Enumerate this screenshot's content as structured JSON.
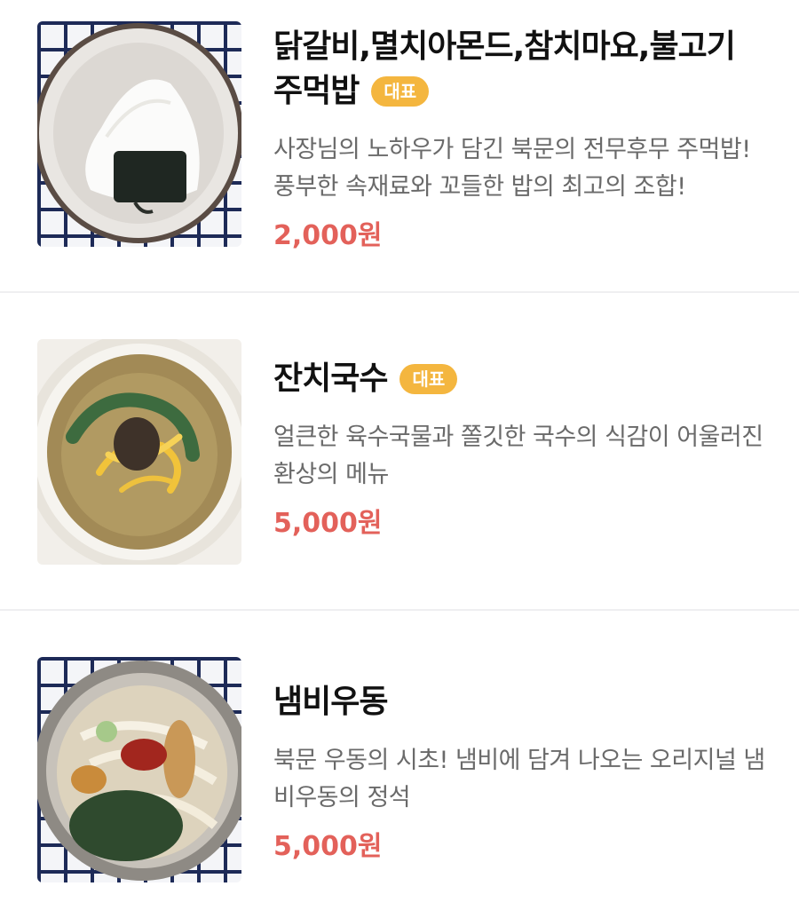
{
  "menu": {
    "items": [
      {
        "name": "닭갈비,멸치아몬드,참치마요,불고기 주먹밥",
        "badge": "대표",
        "description": "사장님의 노하우가 담긴 북문의 전무후무 주먹밥! 풍부한 속재료와 꼬들한 밥의 최고의 조합!",
        "price": "2,000원"
      },
      {
        "name": "잔치국수",
        "badge": "대표",
        "description": "얼큰한 육수국물과 쫄깃한 국수의 식감이 어울러진 환상의 메뉴",
        "price": "5,000원"
      },
      {
        "name": "냄비우동",
        "description": "북문 우동의 시초! 냄비에 담겨 나오는 오리지널 냄비우동의 정석",
        "price": "5,000원"
      }
    ]
  },
  "colors": {
    "price": "#e3615a",
    "badge": "#f4b63f",
    "divider": "#efeff1"
  }
}
